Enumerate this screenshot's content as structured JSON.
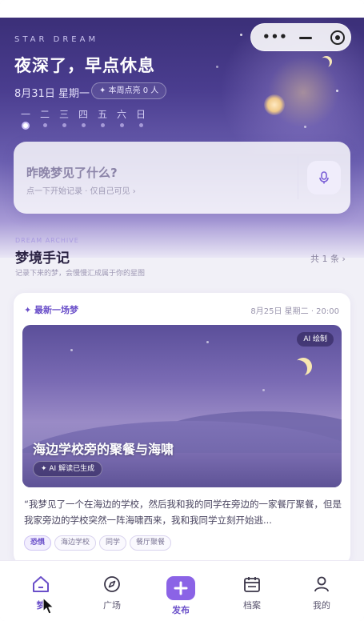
{
  "header": {
    "brand": "STAR DREAM",
    "title": "夜深了，早点休息",
    "date": "8月31日 星期一",
    "lit_badge": "✦ 本周点亮 0 人",
    "week_days": [
      "一",
      "二",
      "三",
      "四",
      "五",
      "六",
      "日"
    ],
    "active_day_index": 0
  },
  "capsule": {
    "more": "•••"
  },
  "dream_input": {
    "question": "昨晚梦见了什么?",
    "hint": "点一下开始记录 · 仅自己可见 ›"
  },
  "archive": {
    "en_label": "DREAM ARCHIVE",
    "title": "梦境手记",
    "subtitle": "记录下来的梦，会慢慢汇成属于你的星图",
    "count": "共 1 条 ›"
  },
  "latest_dream": {
    "section_label": "✦ 最新一场梦",
    "time": "8月25日 星期二 · 20:00",
    "image_badge": "AI 绘制",
    "title": "海边学校旁的聚餐与海啸",
    "ai_badge": "✦ AI 解读已生成",
    "excerpt": "“我梦见了一个在海边的学校，然后我和我的同学在旁边的一家餐厅聚餐，但是我家旁边的学校突然一阵海啸西来，我和我同学立刻开始逃...",
    "tags": [
      "恐惧",
      "海边学校",
      "同学",
      "餐厅聚餐"
    ]
  },
  "nav": {
    "items": [
      {
        "label": "梦",
        "icon": "home-icon"
      },
      {
        "label": "广场",
        "icon": "compass-icon"
      },
      {
        "label": "发布",
        "icon": "plus-icon"
      },
      {
        "label": "档案",
        "icon": "calendar-icon"
      },
      {
        "label": "我的",
        "icon": "user-icon"
      }
    ],
    "active_index": 0
  },
  "colors": {
    "accent": "#6a4fc9",
    "publish": "#8b63e6",
    "hero_top": "#3b2f78"
  }
}
